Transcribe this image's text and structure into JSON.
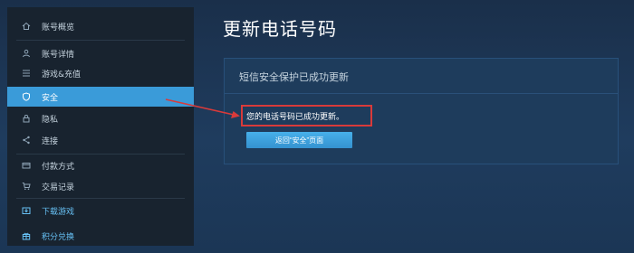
{
  "sidebar": {
    "items": [
      {
        "label": "账号概览",
        "icon": "home-icon"
      },
      {
        "label": "账号详情",
        "icon": "user-icon"
      },
      {
        "label": "游戏&充值",
        "icon": "list-icon"
      },
      {
        "label": "安全",
        "icon": "shield-icon",
        "active": true
      },
      {
        "label": "隐私",
        "icon": "lock-icon"
      },
      {
        "label": "连接",
        "icon": "share-icon"
      },
      {
        "label": "付款方式",
        "icon": "card-icon"
      },
      {
        "label": "交易记录",
        "icon": "cart-icon"
      },
      {
        "label": "下载游戏",
        "icon": "download-icon"
      },
      {
        "label": "积分兑换",
        "icon": "gift-icon"
      }
    ]
  },
  "main": {
    "title": "更新电话号码",
    "card": {
      "heading": "短信安全保护已成功更新",
      "message": "您的电话号码已成功更新。",
      "button_label": "返回“安全”页面"
    }
  },
  "colors": {
    "accent": "#3a9bd9",
    "highlight": "#d93a3a",
    "link": "#67c1f5"
  }
}
